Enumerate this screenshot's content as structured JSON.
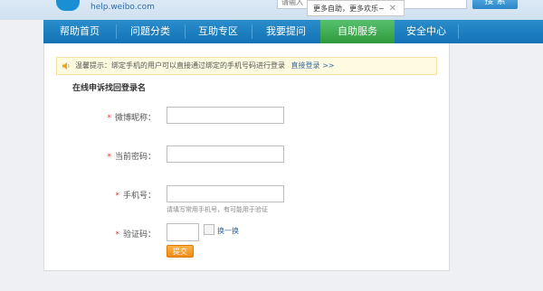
{
  "header": {
    "logo_text": "help.weibo.com",
    "search_placeholder": "请输入",
    "search_button": "搜 索"
  },
  "tooltip": {
    "text": "更多自助，更多欢乐~",
    "close": "✕"
  },
  "nav": {
    "items": [
      "帮助首页",
      "问题分类",
      "互助专区",
      "我要提问",
      "自助服务",
      "安全中心"
    ],
    "active_index": 4
  },
  "tip": {
    "text": "温馨提示：绑定手机的用户可以直接通过绑定的手机号码进行登录",
    "link": "直接登录 >>"
  },
  "form": {
    "title": "在线申诉找回登录名",
    "required_mark": "*",
    "nickname_label": "微博昵称：",
    "password_label": "当前密码：",
    "phone_label": "手机号：",
    "phone_hint": "请填写常用手机号，有可能用于验证",
    "captcha_label": "验证码：",
    "refresh_link": "换一换",
    "submit": "提交"
  },
  "colors": {
    "nav_bg": "#1a7fc1",
    "nav_active": "#3aa64a",
    "link": "#2f6aa8",
    "required": "#e33333",
    "submit": "#f29a1f"
  }
}
